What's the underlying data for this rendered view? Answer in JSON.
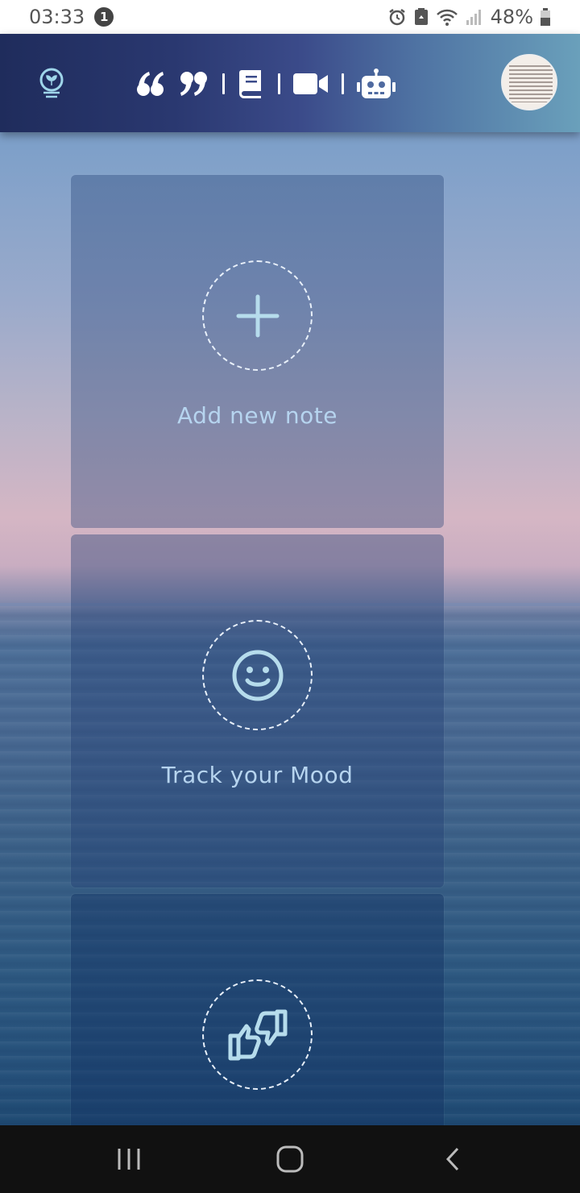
{
  "status_bar": {
    "time": "03:33",
    "notification_count": "1",
    "battery": "48%"
  },
  "header": {
    "icons": [
      "logo-icon",
      "quote-icon",
      "book-icon",
      "video-icon",
      "robot-icon",
      "avatar"
    ]
  },
  "cards": [
    {
      "label": "Add new note",
      "icon": "plus-icon"
    },
    {
      "label": "Track your Mood",
      "icon": "smiley-icon"
    },
    {
      "label": "",
      "icon": "thumbs-up-down-icon"
    }
  ],
  "colors": {
    "card_icon": "#b6dcec",
    "card_label": "#b6d4ef",
    "header_start": "#1f2c5c",
    "header_end": "#6aa0bb"
  }
}
